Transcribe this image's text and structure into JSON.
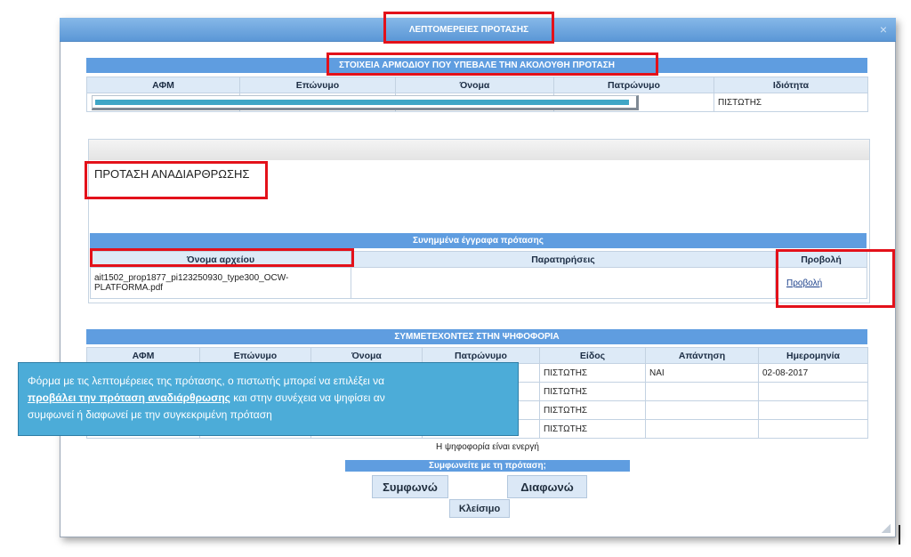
{
  "dialog": {
    "title": "ΛΕΠΤΟΜΕΡΕΙΕΣ ΠΡΟΤΑΣΗΣ",
    "close_icon": "close-icon"
  },
  "submitter": {
    "section_title": "ΣΤΟΙΧΕΙΑ ΑΡΜΟΔΙΟΥ ΠΟΥ ΥΠΕΒΑΛΕ ΤΗΝ ΑΚΟΛΟΥΘΗ ΠΡΟΤΑΣΗ",
    "columns": [
      "ΑΦΜ",
      "Επώνυμο",
      "Όνομα",
      "Πατρώνυμο",
      "Ιδιότητα"
    ],
    "row_role": "ΠΙΣΤΩΤΗΣ"
  },
  "proposal": {
    "title": "ΠΡΟΤΑΣΗ ΑΝΑΔΙΑΡΘΡΩΣΗΣ"
  },
  "attachments": {
    "section_title": "Συνημμένα έγγραφα πρότασης",
    "columns": [
      "Όνομα αρχείου",
      "Παρατηρήσεις",
      "Προβολή"
    ],
    "file_name_line1": "ait1502_prop1877_pi123250930_type300_OCW-",
    "file_name_line2": "PLATFORMA.pdf",
    "view_link": "Προβολή"
  },
  "voters": {
    "section_title": "ΣΥΜΜΕΤΕΧΟΝΤΕΣ ΣΤΗΝ ΨΗΦΟΦΟΡΙΑ",
    "columns": [
      "ΑΦΜ",
      "Επώνυμο",
      "Όνομα",
      "Πατρώνυμο",
      "Είδος",
      "Απάντηση",
      "Ημερομηνία"
    ],
    "rows": [
      {
        "kind": "ΠΙΣΤΩΤΗΣ",
        "answer": "ΝΑΙ",
        "date": "02-08-2017"
      },
      {
        "kind": "ΠΙΣΤΩΤΗΣ",
        "answer": "",
        "date": ""
      },
      {
        "kind": "ΠΙΣΤΩΤΗΣ",
        "answer": "",
        "date": ""
      },
      {
        "kind": "ΠΙΣΤΩΤΗΣ",
        "answer": "",
        "date": ""
      }
    ]
  },
  "voting": {
    "status": "Η ψηφοφορία είναι ενεργή",
    "question": "Συμφωνείτε με τη πρόταση;",
    "agree": "Συμφωνώ",
    "disagree": "Διαφωνώ",
    "close": "Κλείσιμο"
  },
  "tooltip": {
    "part1": "Φόρμα με τις λεπτομέρειες της πρότασης, ο πιστωτής μπορεί να επιλέξει να",
    "bold": "προβάλει την πρόταση αναδιάρθρωσης",
    "part2": " και στην συνέχεια να ψηφίσει αν",
    "part3": "συμφωνεί ή διαφωνεί με την συγκεκριμένη πρόταση"
  },
  "colors": {
    "title_bar": "#5b97d6",
    "section_bar": "#5f9de0",
    "header_cell": "#ddeaf7",
    "highlight": "#e3111a",
    "tooltip": "#4cacd8"
  }
}
